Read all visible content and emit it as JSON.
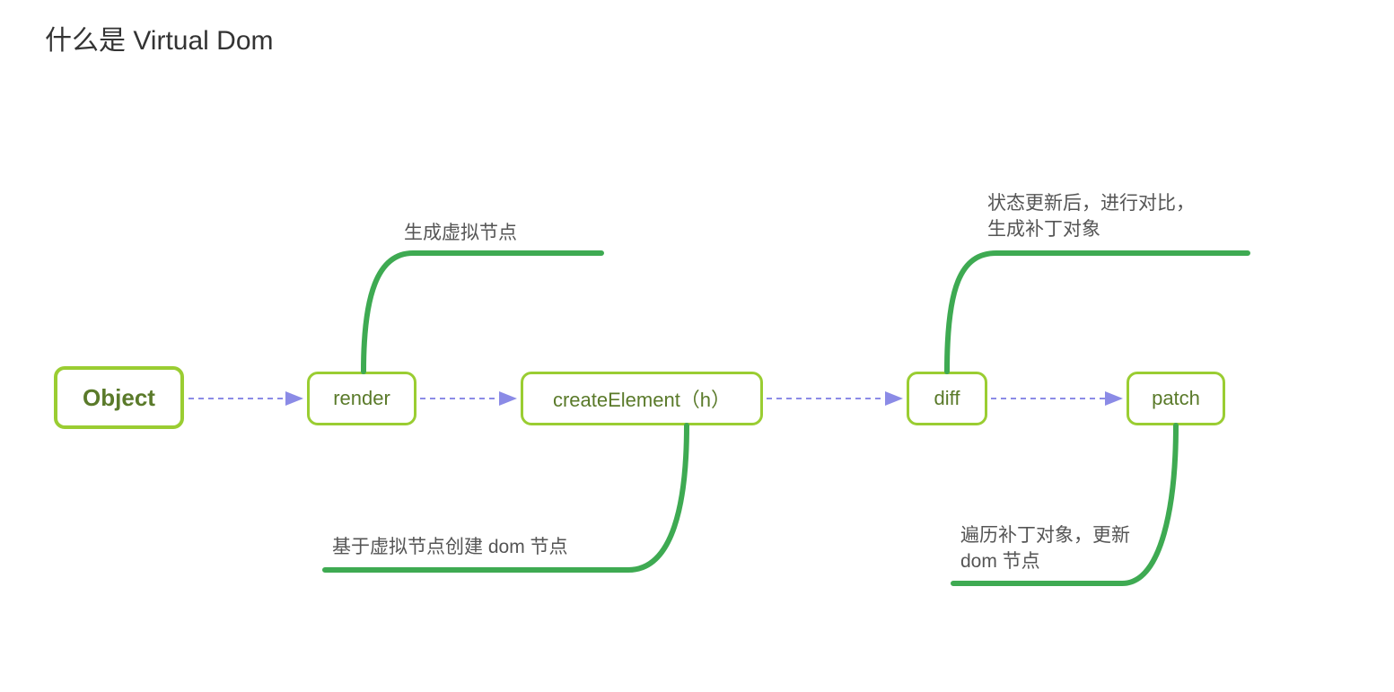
{
  "title": "什么是 Virtual Dom",
  "nodes": {
    "object": "Object",
    "render": "render",
    "createElement": "createElement（h）",
    "diff": "diff",
    "patch": "patch"
  },
  "annotations": {
    "render_top": "生成虚拟节点",
    "create_bottom": "基于虚拟节点创建 dom 节点",
    "diff_top": "状态更新后，进行对比，生成补丁对象",
    "patch_bottom": "遍历补丁对象，更新 dom 节点"
  }
}
